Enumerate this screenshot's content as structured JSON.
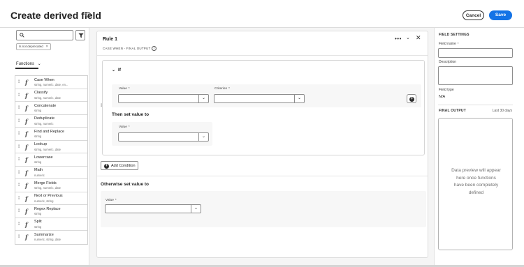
{
  "header": {
    "title": "Create derived field",
    "cancel_label": "Cancel",
    "save_label": "Save",
    "save_color": "#1473e6"
  },
  "left_panel": {
    "search": {
      "value": "",
      "placeholder": ""
    },
    "tag": "Is not deprecated",
    "tab_label": "Functions",
    "functions": [
      {
        "name": "Case When",
        "types": "string, numeric, date, en..."
      },
      {
        "name": "Classify",
        "types": "string, numeric, date"
      },
      {
        "name": "Concatenate",
        "types": "string"
      },
      {
        "name": "Deduplicate",
        "types": "string, numeric"
      },
      {
        "name": "Find and Replace",
        "types": "string"
      },
      {
        "name": "Lookup",
        "types": "string, numeric, date"
      },
      {
        "name": "Lowercase",
        "types": "string"
      },
      {
        "name": "Math",
        "types": "numeric"
      },
      {
        "name": "Merge Fields",
        "types": "string, numeric, date"
      },
      {
        "name": "Next or Previous",
        "types": "numeric, string"
      },
      {
        "name": "Regex Replace",
        "types": "string"
      },
      {
        "name": "Split",
        "types": "string"
      },
      {
        "name": "Summarize",
        "types": "numeric, string, date"
      }
    ]
  },
  "rule": {
    "title": "Rule 1",
    "subtitle": "CASE WHEN - FINAL OUTPUT",
    "if_label": "If",
    "value_label": "Value",
    "criterion_label": "Criterion",
    "required_mark": "*",
    "then_label": "Then set value to",
    "then_value_label": "Value",
    "add_condition_label": "Add Condition",
    "otherwise_label": "Otherwise set value to",
    "otherwise_value_label": "Value"
  },
  "right_panel": {
    "field_settings": "FIELD SETTINGS",
    "field_name_label": "Field name",
    "description_label": "Description",
    "field_type_label": "Field type",
    "field_type_value": "N/A",
    "final_output": "FINAL OUTPUT",
    "time_range": "Last 30 days",
    "preview_text": "Data preview will appear here once functions have been completely defined"
  }
}
